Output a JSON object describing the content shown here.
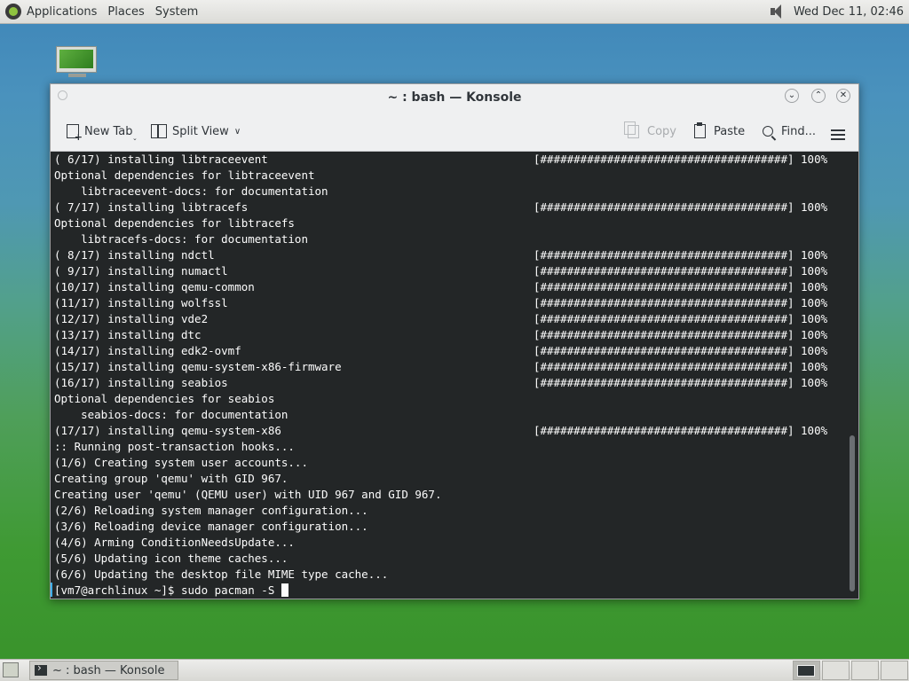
{
  "top_panel": {
    "menus": [
      "Applications",
      "Places",
      "System"
    ],
    "clock": "Wed Dec 11, 02:46"
  },
  "window": {
    "title": "~ : bash — Konsole",
    "toolbar": {
      "new_tab": "New Tab",
      "split_view": "Split View",
      "copy": "Copy",
      "paste": "Paste",
      "find": "Find..."
    }
  },
  "terminal": {
    "lines": [
      "( 6/17) installing libtraceevent",
      "Optional dependencies for libtraceevent",
      "    libtraceevent-docs: for documentation",
      "( 7/17) installing libtracefs",
      "Optional dependencies for libtracefs",
      "    libtracefs-docs: for documentation",
      "( 8/17) installing ndctl",
      "( 9/17) installing numactl",
      "(10/17) installing qemu-common",
      "(11/17) installing wolfssl",
      "(12/17) installing vde2",
      "(13/17) installing dtc",
      "(14/17) installing edk2-ovmf",
      "(15/17) installing qemu-system-x86-firmware",
      "(16/17) installing seabios",
      "Optional dependencies for seabios",
      "    seabios-docs: for documentation",
      "(17/17) installing qemu-system-x86",
      ":: Running post-transaction hooks...",
      "(1/6) Creating system user accounts...",
      "Creating group 'qemu' with GID 967.",
      "Creating user 'qemu' (QEMU user) with UID 967 and GID 967.",
      "(2/6) Reloading system manager configuration...",
      "(3/6) Reloading device manager configuration...",
      "(4/6) Arming ConditionNeedsUpdate...",
      "(5/6) Updating icon theme caches...",
      "(6/6) Updating the desktop file MIME type cache..."
    ],
    "progress_bar": "[#####################################] 100%",
    "prompt": "[vm7@archlinux ~]$ sudo pacman -S "
  },
  "taskbar": {
    "task_label": "~ : bash — Konsole"
  }
}
